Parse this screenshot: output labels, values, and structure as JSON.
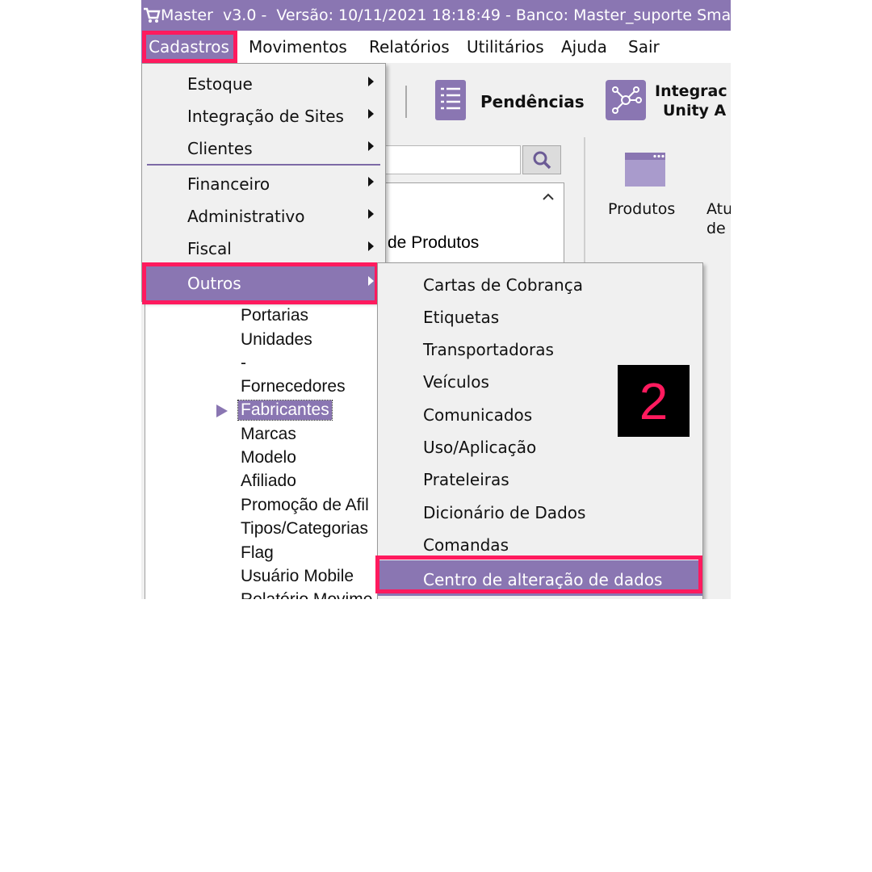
{
  "titlebar": {
    "text": "Master  v3.0 -  Versão: 10/11/2021 18:18:49 - Banco: Master_suporte Sma"
  },
  "menubar": {
    "items": [
      "Cadastros",
      "Movimentos",
      "Relatórios",
      "Utilitários",
      "Ajuda",
      "Sair"
    ]
  },
  "toolbar": {
    "pendencias": "Pendências",
    "integracao_line1": "Integrac",
    "integracao_line2": "Unity A"
  },
  "tree": {
    "partial_label": "de Produtos",
    "items": [
      "Portarias",
      "Unidades",
      "-",
      "Fornecedores",
      "Fabricantes",
      "Marcas",
      "Modelo",
      "Afiliado",
      "Promoção de Afil",
      "Tipos/Categorias",
      "Flag",
      "Usuário Mobile",
      "Relatório Movime"
    ]
  },
  "rightpanel": {
    "produtos": "Produtos",
    "atu_line1": "Atu",
    "atu_line2": "de"
  },
  "cadastros_menu": {
    "items": [
      "Estoque",
      "Integração de Sites",
      "Clientes",
      "Financeiro",
      "Administrativo",
      "Fiscal",
      "Outros"
    ]
  },
  "outros_menu": {
    "items": [
      "Cartas de Cobrança",
      "Etiquetas",
      "Transportadoras",
      "Veículos",
      "Comunicados",
      "Uso/Aplicação",
      "Prateleiras",
      "Dicionário de Dados",
      "Comandas",
      "Centro de alteração de dados"
    ]
  },
  "step_badge": "2",
  "colors": {
    "accent": "#8a76b2",
    "highlight": "#ff1a5e",
    "badge_bg": "#000000"
  }
}
